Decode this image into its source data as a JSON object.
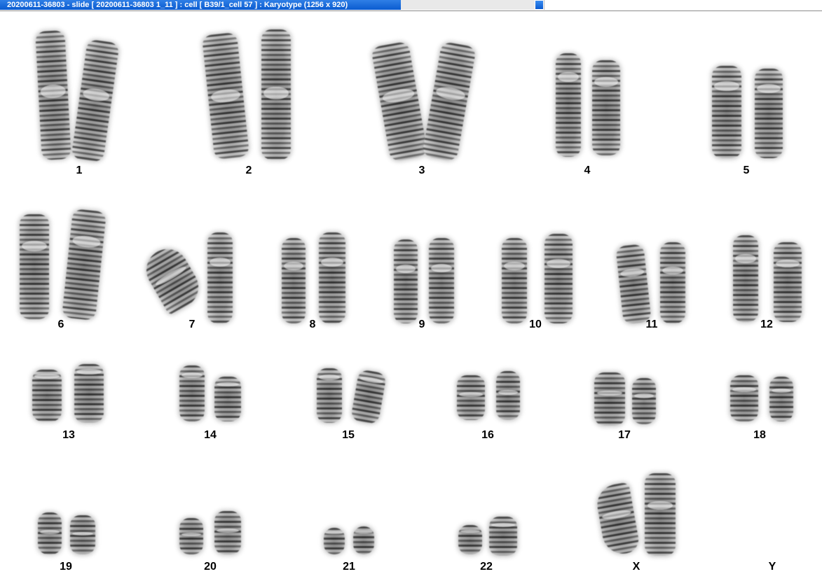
{
  "window": {
    "title": "20200611-36803 - slide [ 20200611-36803 1_11 ] : cell [ B39/1_cell 57 ] : Karyotype  (1256 x 920)"
  },
  "karyotype": {
    "labels": {
      "c1": "1",
      "c2": "2",
      "c3": "3",
      "c4": "4",
      "c5": "5",
      "c6": "6",
      "c7": "7",
      "c8": "8",
      "c9": "9",
      "c10": "10",
      "c11": "11",
      "c12": "12",
      "c13": "13",
      "c14": "14",
      "c15": "15",
      "c16": "16",
      "c17": "17",
      "c18": "18",
      "c19": "19",
      "c20": "20",
      "c21": "21",
      "c22": "22",
      "cx": "X",
      "cy": "Y"
    }
  }
}
